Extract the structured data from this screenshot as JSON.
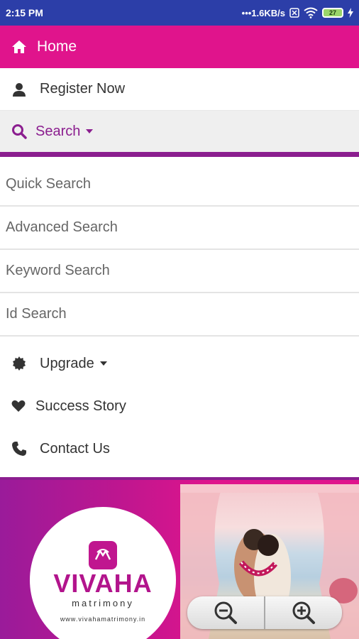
{
  "status_bar": {
    "time": "2:15 PM",
    "network_speed": "•••1.6KB/s",
    "battery_level": "27"
  },
  "menu": {
    "home_label": "Home",
    "register_label": "Register Now",
    "search_label": "Search",
    "search_submenu": [
      "Quick Search",
      "Advanced Search",
      "Keyword Search",
      "Id Search"
    ],
    "upgrade_label": "Upgrade",
    "success_label": "Success Story",
    "contact_label": "Contact Us"
  },
  "banner": {
    "brand": "VIVAHA",
    "brand_sub": "matrimony",
    "url": "www.vivahamatrimony.in"
  },
  "icons": {
    "home": "home-icon",
    "register": "user-icon",
    "search": "search-icon",
    "upgrade": "badge-icon",
    "success": "heart-icon",
    "contact": "phone-icon",
    "zoom_out": "zoom-out-icon",
    "zoom_in": "zoom-in-icon"
  },
  "colors": {
    "status_bar": "#2c3ea8",
    "home_bg": "#e0148c",
    "accent_purple": "#8b1e8f",
    "search_bg": "#efefef"
  }
}
